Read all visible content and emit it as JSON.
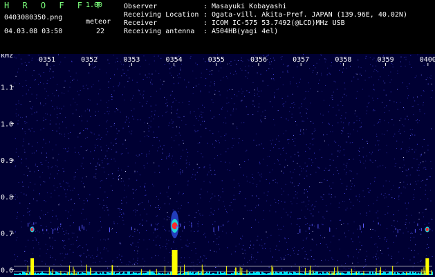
{
  "header": {
    "title": "H R O F F T",
    "version": "1.00",
    "file_name": "0403080350.png",
    "meteor_label": "meteor",
    "datetime": "04.03.08 03:50",
    "meteor_count": "22",
    "info": [
      {
        "label": "Observer",
        "value": "Masayuki Kobayashi"
      },
      {
        "label": "Receiving Location",
        "value": "Ogata-vill. Akita-Pref. JAPAN (139.96E, 40.02N)"
      },
      {
        "label": "Receiver",
        "value": "ICOM IC-575 53.7492(@LCD)MHz USB"
      },
      {
        "label": "Receiving antenna",
        "value": "A504HB(yagi 4el)"
      }
    ],
    "colon": ":"
  },
  "chart_data": {
    "type": "heatmap",
    "title": "",
    "ylabel": "kHz",
    "xlabel": "",
    "x_ticks": [
      "0351",
      "0352",
      "0353",
      "0354",
      "0355",
      "0356",
      "0357",
      "0358",
      "0359",
      "0400"
    ],
    "y_ticks": [
      "1.1",
      "1.0",
      "0.9",
      "0.8",
      "0.7",
      "0.6"
    ],
    "ylim": [
      0.58,
      1.19
    ],
    "grid": false,
    "background_color": "#000033",
    "noise_color": "#3b3bd8",
    "signal_color": "#ff2a2a",
    "level_color": "#ffff00",
    "baseline_color": "#00e5ff",
    "echoes": [
      {
        "time": "03:50:39",
        "freq_khz": 0.71,
        "strength": "weak"
      },
      {
        "time": "03:54:01",
        "freq_khz": 0.72,
        "strength": "strong"
      },
      {
        "time": "03:59:59",
        "freq_khz": 0.71,
        "strength": "weak"
      }
    ]
  }
}
